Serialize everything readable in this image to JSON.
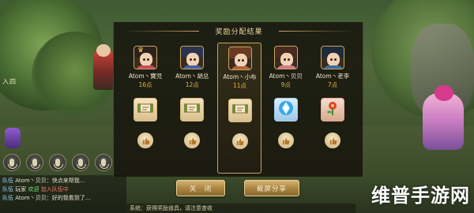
{
  "dialog": {
    "title": "奖励分配结果",
    "players": [
      {
        "name": "Atom丶寶児",
        "points": "16点",
        "item": "scroll",
        "selected": false,
        "crown": true,
        "hair": "#2b2220",
        "cloth": "#c44d5a"
      },
      {
        "name": "Atom丶胡总",
        "points": "12点",
        "item": "scroll",
        "selected": false,
        "crown": false,
        "hair": "#2a3350",
        "cloth": "#4563a8"
      },
      {
        "name": "Atom丶小布",
        "points": "11点",
        "item": "scroll",
        "selected": true,
        "crown": false,
        "hair": "#6b3a22",
        "cloth": "#b0663a"
      },
      {
        "name": "Atom丶贝贝",
        "points": "9点",
        "item": "crystal",
        "selected": false,
        "crown": false,
        "hair": "#4a2a1e",
        "cloth": "#d37a86"
      },
      {
        "name": "Atom丶老李",
        "points": "7点",
        "item": "flower",
        "selected": false,
        "crown": false,
        "hair": "#1e2a3a",
        "cloth": "#3a6f9a"
      }
    ]
  },
  "buttons": {
    "close": "关　闭",
    "share": "截屏分享"
  },
  "hud": {
    "label": "入四"
  },
  "chat": {
    "lines": [
      {
        "tag": "队伍",
        "text": "Atom丶贝贝：快点来帮我..."
      },
      {
        "tag": "队伍",
        "text": "玩家",
        "hl": "欢迎",
        "rest": "加入队伍中"
      },
      {
        "tag": "队伍",
        "text": "Atom丶贝贝：好的我看到了..."
      }
    ],
    "bottom": "系统：获得奖励道具，请注意查收"
  },
  "watermark": "维普手游网",
  "colors": {
    "gold": "#c9a65e",
    "points": "#e5b24a",
    "button": "#a8833f"
  }
}
